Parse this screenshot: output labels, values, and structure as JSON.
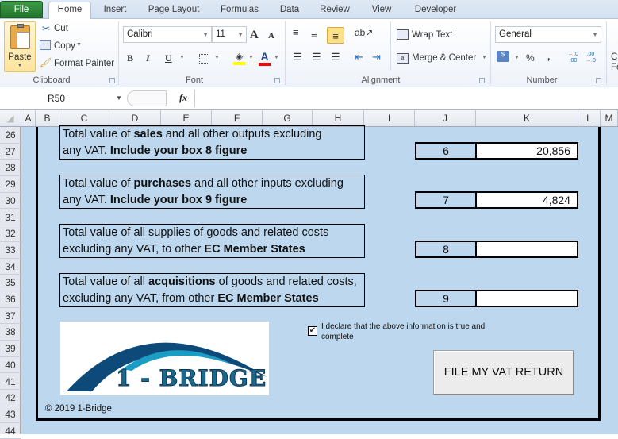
{
  "tabs": [
    {
      "label": "File",
      "active": false
    },
    {
      "label": "Home",
      "active": true
    },
    {
      "label": "Insert"
    },
    {
      "label": "Page Layout"
    },
    {
      "label": "Formulas"
    },
    {
      "label": "Data"
    },
    {
      "label": "Review"
    },
    {
      "label": "View"
    },
    {
      "label": "Developer"
    }
  ],
  "ribbon": {
    "clipboard": {
      "group": "Clipboard",
      "paste": "Paste",
      "cut": "Cut",
      "copy": "Copy",
      "format_painter": "Format Painter"
    },
    "font": {
      "group": "Font",
      "name": "Calibri",
      "size": "11",
      "bold": "B",
      "italic": "I",
      "underline": "U",
      "grow": "A",
      "shrink": "A",
      "fill_color": "#ffff00",
      "font_color": "#ff0000"
    },
    "alignment": {
      "group": "Alignment",
      "wrap_text": "Wrap Text",
      "merge_center": "Merge & Center"
    },
    "number": {
      "group": "Number",
      "format": "General",
      "percent": "%",
      "comma": ",",
      "inc_decimal": "←.0 .00",
      "dec_decimal": ".00 →.0"
    },
    "cut_off": {
      "line1": "C",
      "line2": "Fo"
    }
  },
  "formula_bar": {
    "name_box": "R50",
    "fx": "fx",
    "formula": ""
  },
  "columns": [
    "A",
    "B",
    "C",
    "D",
    "E",
    "F",
    "G",
    "H",
    "I",
    "J",
    "K",
    "L",
    "M"
  ],
  "rows": [
    "26",
    "27",
    "28",
    "29",
    "30",
    "31",
    "32",
    "33",
    "34",
    "35",
    "36",
    "37",
    "38",
    "39",
    "40",
    "41",
    "42",
    "43",
    "44"
  ],
  "form": {
    "items": [
      {
        "line1_pre": "Total value of ",
        "line1_bold": "sales",
        "line1_post": " and all other outputs excluding",
        "line2_pre": "any VAT. ",
        "line2_bold": "Include your box 8 figure",
        "line2_post": "",
        "box": "6",
        "value": "20,856"
      },
      {
        "line1_pre": "Total value of ",
        "line1_bold": "purchases",
        "line1_post": " and all other inputs excluding",
        "line2_pre": "any VAT. ",
        "line2_bold": "Include your box 9 figure",
        "line2_post": "",
        "box": "7",
        "value": "4,824"
      },
      {
        "line1_pre": "Total value of all supplies of goods and related costs",
        "line1_bold": "",
        "line1_post": "",
        "line2_pre": "excluding any VAT, to other ",
        "line2_bold": "EC Member States",
        "line2_post": "",
        "box": "8",
        "value": ""
      },
      {
        "line1_pre": "Total value of all ",
        "line1_bold": "acquisitions",
        "line1_post": " of goods and related costs,",
        "line2_pre": "excluding any VAT, from other ",
        "line2_bold": "EC Member States",
        "line2_post": "",
        "box": "9",
        "value": ""
      }
    ],
    "logo_text": "1 - BRIDGE",
    "declaration": "I declare that the above information is true and complete",
    "declaration_checked": true,
    "submit_label": "FILE MY VAT RETURN",
    "copyright": "© 2019 1-Bridge"
  },
  "colors": {
    "sheet_bg": "#bdd7ee",
    "logo_dark": "#0d4a7a",
    "logo_light": "#1a9cc4",
    "file_tab": "#2e8b3a"
  }
}
